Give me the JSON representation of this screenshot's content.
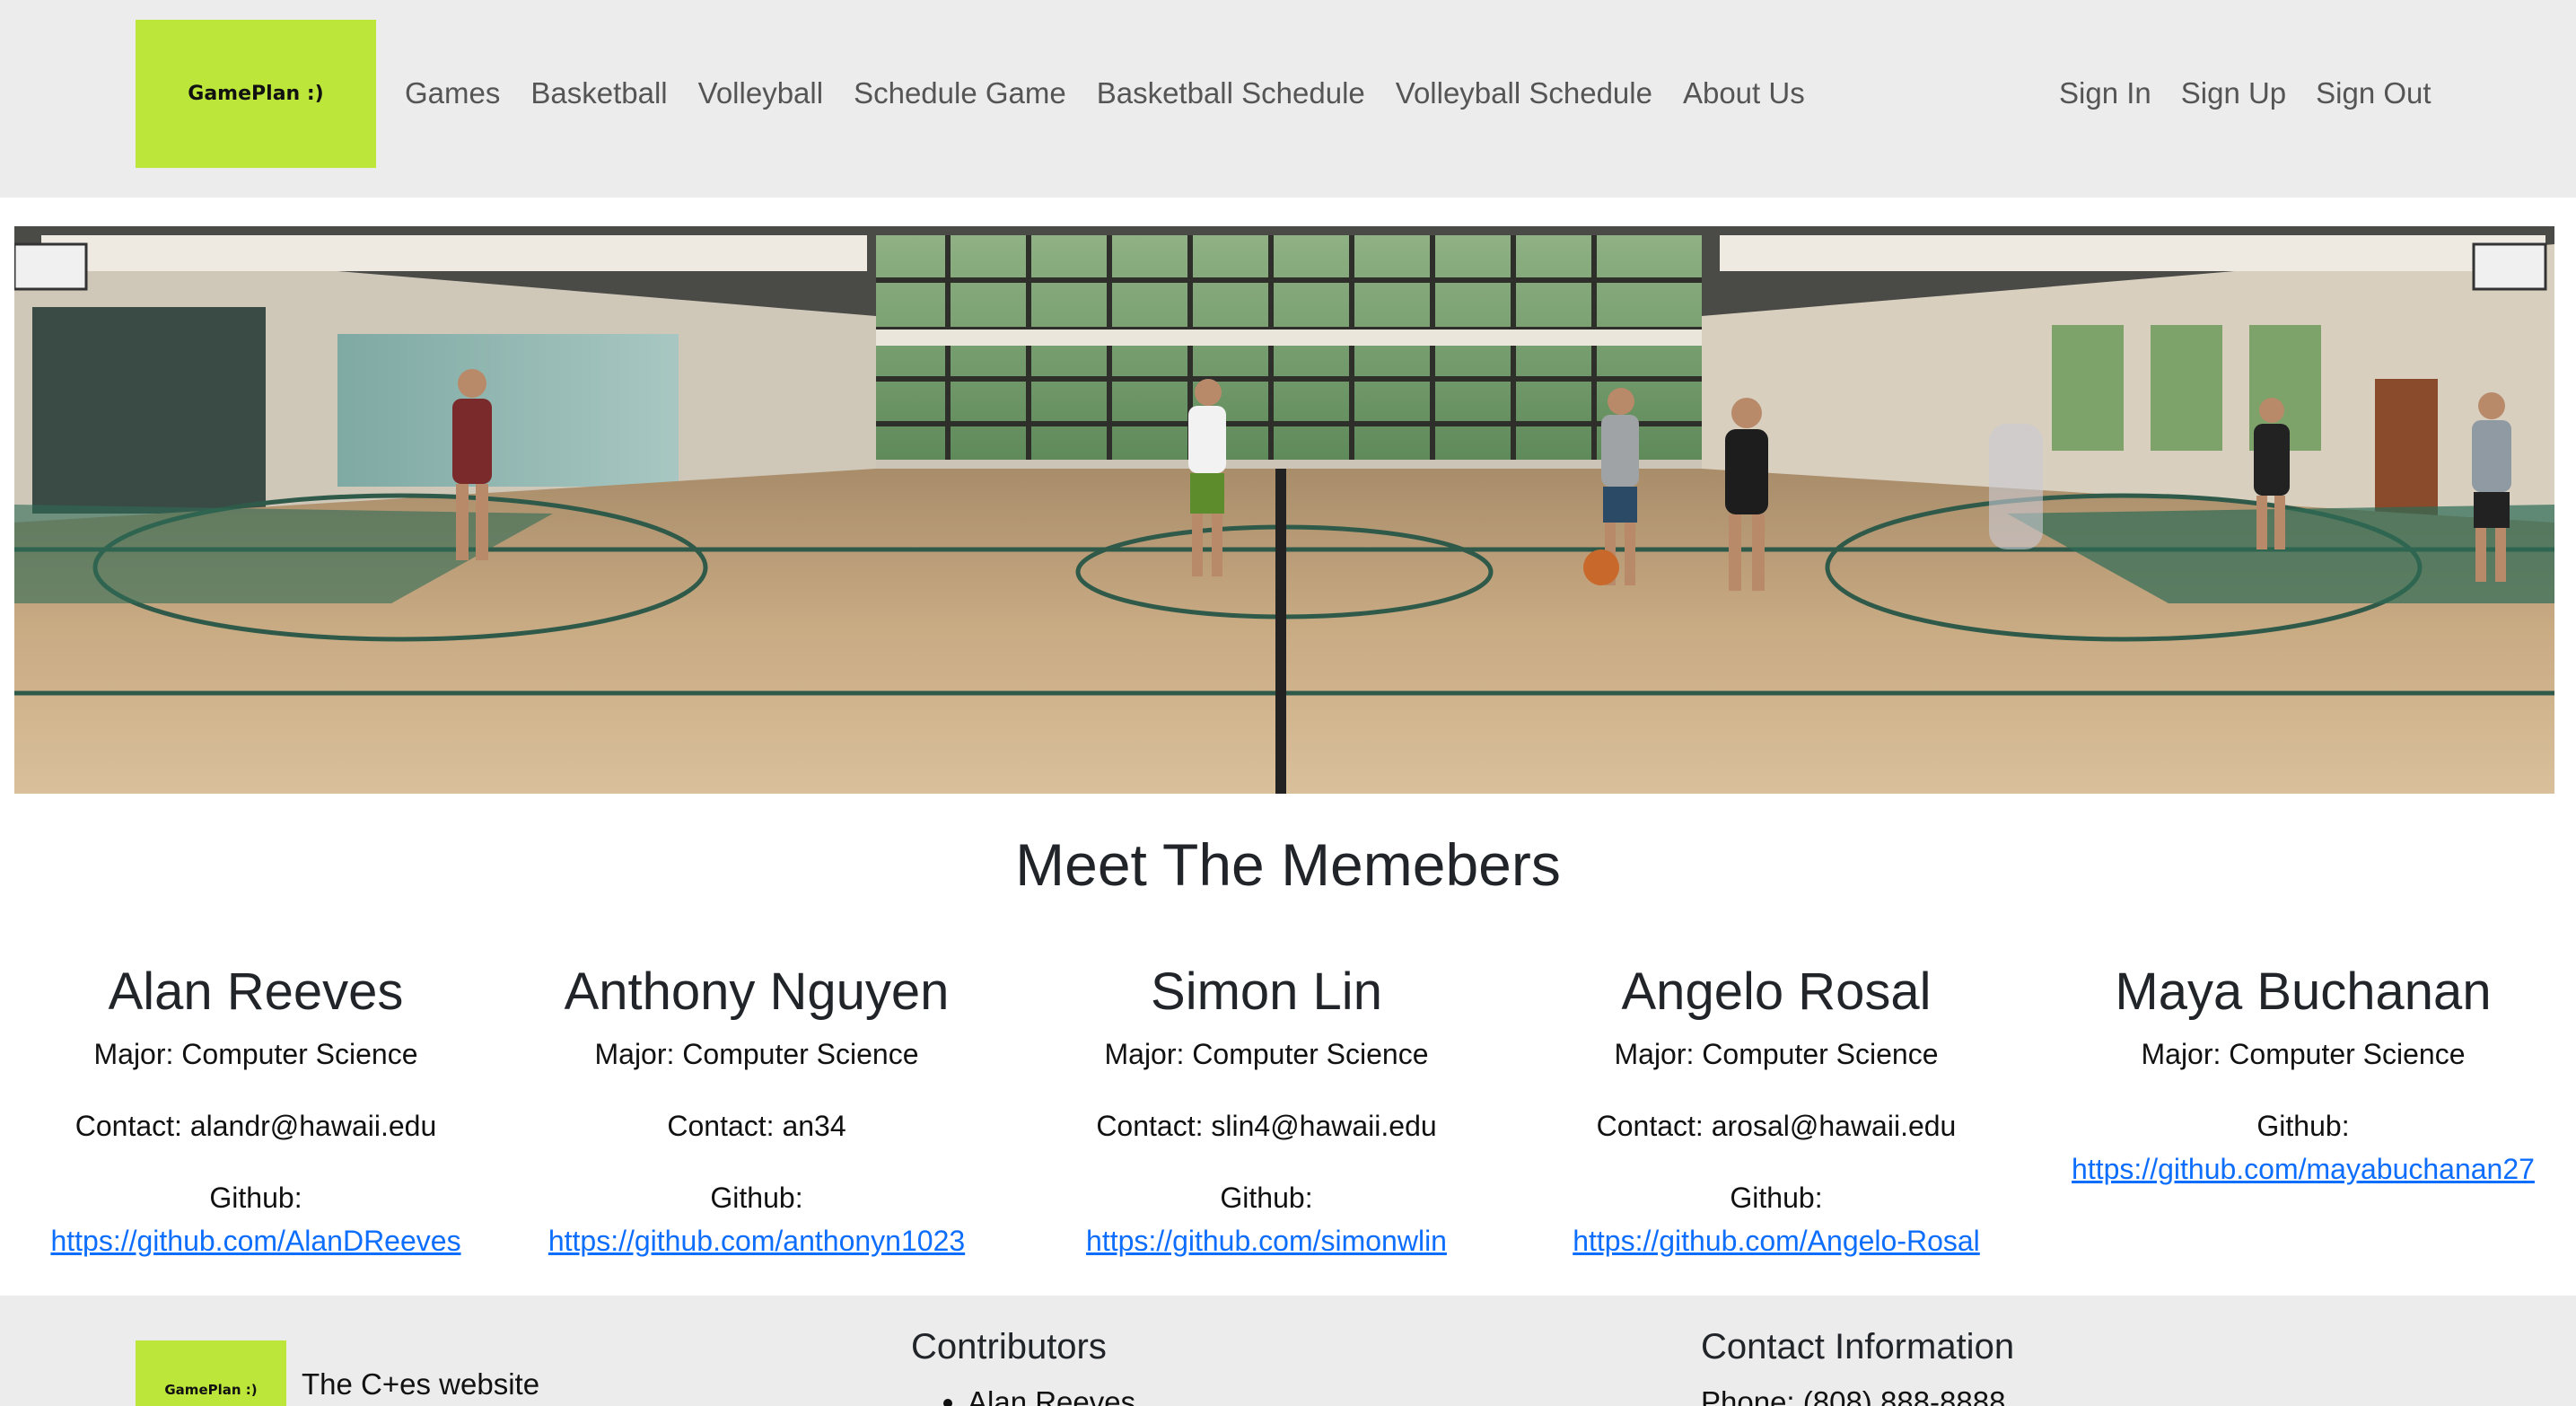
{
  "brand": {
    "logo_text": "GamePlan :)",
    "accent_color": "#bde63b"
  },
  "nav": {
    "links": [
      "Games",
      "Basketball",
      "Volleyball",
      "Schedule Game",
      "Basketball Schedule",
      "Volleyball Schedule",
      "About Us"
    ],
    "auth_links": [
      "Sign In",
      "Sign Up",
      "Sign Out"
    ]
  },
  "hero": {
    "image": "basketball-gym-photo"
  },
  "members_section": {
    "title": "Meet The Memebers",
    "members": [
      {
        "name": "Alan Reeves",
        "major": "Major: Computer Science",
        "contact": "Contact: alandr@hawaii.edu",
        "github_label": "Github:",
        "github_url": "https://github.com/AlanDReeves"
      },
      {
        "name": "Anthony Nguyen",
        "major": "Major: Computer Science",
        "contact": "Contact: an34",
        "github_label": "Github:",
        "github_url": "https://github.com/anthonyn1023"
      },
      {
        "name": "Simon Lin",
        "major": "Major: Computer Science",
        "contact": "Contact: slin4@hawaii.edu",
        "github_label": "Github:",
        "github_url": "https://github.com/simonwlin"
      },
      {
        "name": "Angelo Rosal",
        "major": "Major: Computer Science",
        "contact": "Contact: arosal@hawaii.edu",
        "github_label": "Github:",
        "github_url": "https://github.com/Angelo-Rosal"
      },
      {
        "name": "Maya Buchanan",
        "major": "Major: Computer Science",
        "github_label": "Github:",
        "github_url": "https://github.com/mayabuchanan27"
      }
    ]
  },
  "footer": {
    "logo_text": "GamePlan :)",
    "site_text": "The C+es website",
    "contributors_heading": "Contributors",
    "contributors": [
      "Alan Reeves"
    ],
    "contact_heading": "Contact Information",
    "phone": "Phone: (808) 888-8888"
  }
}
